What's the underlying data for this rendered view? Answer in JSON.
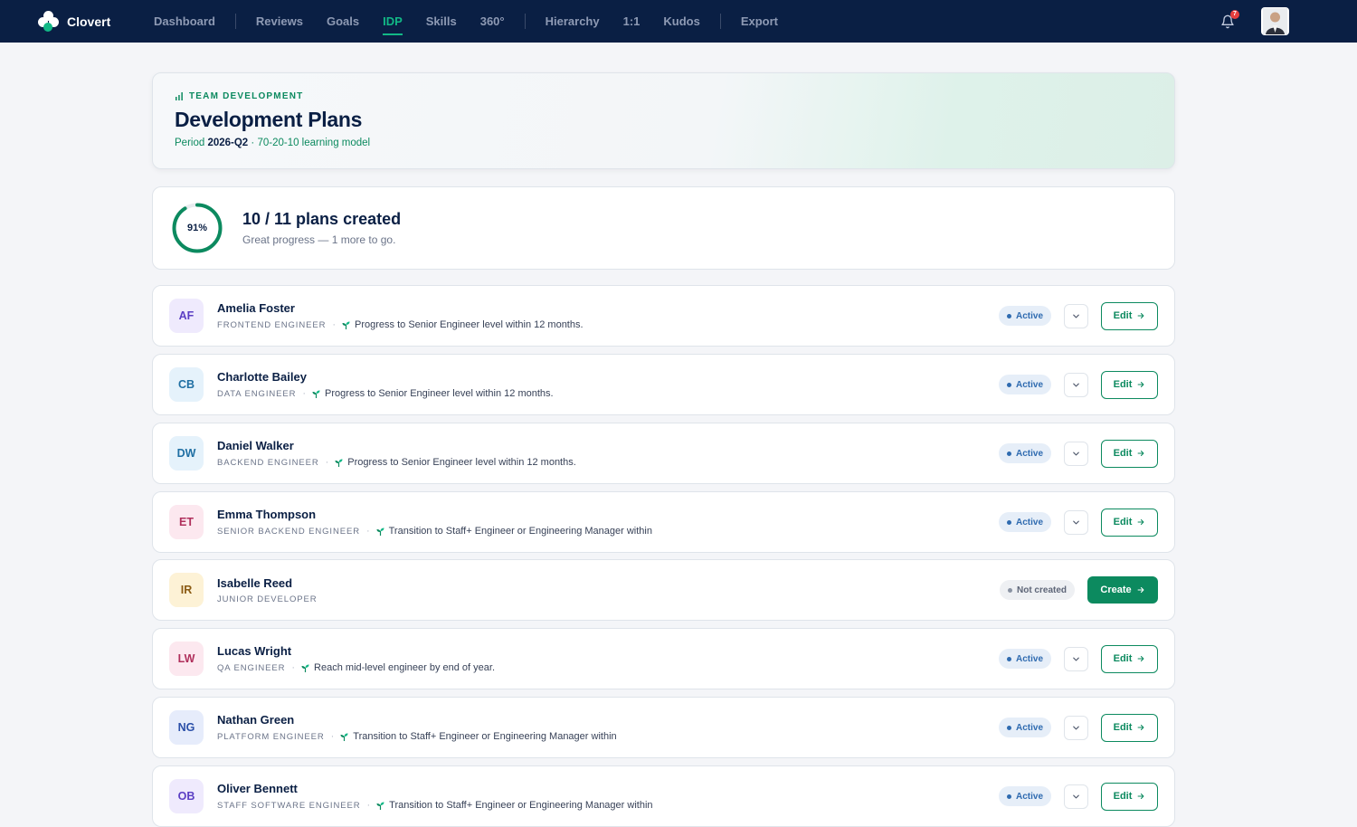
{
  "app": {
    "name": "Clovert",
    "notification_count": "7"
  },
  "nav": {
    "groups": [
      [
        "Dashboard"
      ],
      [
        "Reviews",
        "Goals",
        "IDP",
        "Skills",
        "360°"
      ],
      [
        "Hierarchy",
        "1:1",
        "Kudos"
      ],
      [
        "Export"
      ]
    ],
    "active": "IDP"
  },
  "hero": {
    "eyebrow": "TEAM DEVELOPMENT",
    "title": "Development Plans",
    "period_label": "Period",
    "period_value": "2026-Q2",
    "model": "· 70-20-10 learning model"
  },
  "progress": {
    "percent_label": "91%",
    "fraction": 0.91,
    "title": "10 / 11 plans created",
    "subtitle": "Great progress — 1 more to go."
  },
  "actions": {
    "edit_label": "Edit",
    "create_label": "Create"
  },
  "rows": [
    {
      "initials": "AF",
      "name": "Amelia Foster",
      "role": "FRONTEND ENGINEER",
      "goal": "Progress to Senior Engineer level within 12 months.",
      "status": "Active",
      "bg": "#efeafd",
      "fg": "#5b3fc4"
    },
    {
      "initials": "CB",
      "name": "Charlotte Bailey",
      "role": "DATA ENGINEER",
      "goal": "Progress to Senior Engineer level within 12 months.",
      "status": "Active",
      "bg": "#e5f2fb",
      "fg": "#1f6fa3"
    },
    {
      "initials": "DW",
      "name": "Daniel Walker",
      "role": "BACKEND ENGINEER",
      "goal": "Progress to Senior Engineer level within 12 months.",
      "status": "Active",
      "bg": "#e5f2fb",
      "fg": "#1f6fa3"
    },
    {
      "initials": "ET",
      "name": "Emma Thompson",
      "role": "SENIOR BACKEND ENGINEER",
      "goal": "Transition to Staff+ Engineer or Engineering Manager within",
      "status": "Active",
      "bg": "#fce8ef",
      "fg": "#b0305c"
    },
    {
      "initials": "IR",
      "name": "Isabelle Reed",
      "role": "JUNIOR DEVELOPER",
      "goal": "",
      "status": "Not created",
      "bg": "#fdf2d6",
      "fg": "#8a5a12"
    },
    {
      "initials": "LW",
      "name": "Lucas Wright",
      "role": "QA ENGINEER",
      "goal": "Reach mid-level engineer by end of year.",
      "status": "Active",
      "bg": "#fce8ef",
      "fg": "#b0305c"
    },
    {
      "initials": "NG",
      "name": "Nathan Green",
      "role": "PLATFORM ENGINEER",
      "goal": "Transition to Staff+ Engineer or Engineering Manager within",
      "status": "Active",
      "bg": "#e6ecfb",
      "fg": "#2a4fa8"
    },
    {
      "initials": "OB",
      "name": "Oliver Bennett",
      "role": "STAFF SOFTWARE ENGINEER",
      "goal": "Transition to Staff+ Engineer or Engineering Manager within",
      "status": "Active",
      "bg": "#efeafd",
      "fg": "#5b3fc4"
    }
  ]
}
